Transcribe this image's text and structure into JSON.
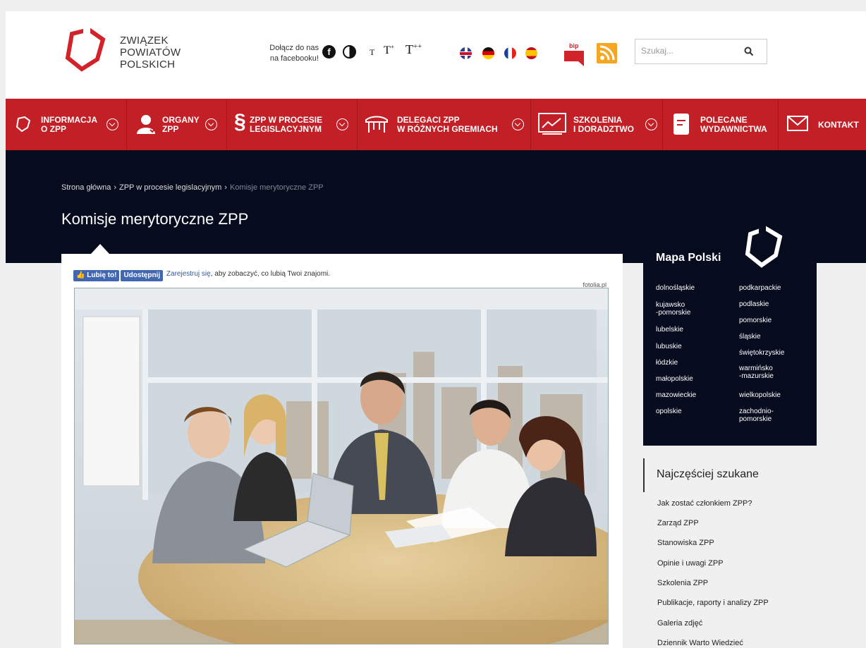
{
  "header": {
    "logo_lines": [
      "ZWIĄZEK",
      "POWIATÓW",
      "POLSKICH"
    ],
    "fb_join_line1": "Dołącz do nas",
    "fb_join_line2": "na facebooku!",
    "font_sizes": [
      "T",
      "T+",
      "T++"
    ],
    "languages": [
      "uk-flag",
      "german-flag",
      "french-flag",
      "spanish-flag"
    ],
    "bip_label": "bip",
    "search_placeholder": "Szukaj..."
  },
  "nav": {
    "items": [
      {
        "line1": "INFORMACJA",
        "line2": "O ZPP",
        "icon": "zpp-logo-icon",
        "has_dropdown": true
      },
      {
        "line1": "ORGANY",
        "line2": "ZPP",
        "icon": "user-icon",
        "has_dropdown": true
      },
      {
        "line1": "ZPP W PROCESIE",
        "line2": "LEGISLACYJNYM",
        "icon": "paragraph-icon",
        "has_dropdown": true
      },
      {
        "line1": "DELEGACI ZPP",
        "line2": "W RÓŻNYCH GREMIACH",
        "icon": "table-icon",
        "has_dropdown": true
      },
      {
        "line1": "SZKOLENIA",
        "line2": "I DORADZTWO",
        "icon": "presentation-icon",
        "has_dropdown": true
      },
      {
        "line1": "POLECANE",
        "line2": "WYDAWNICTWA",
        "icon": "book-icon",
        "has_dropdown": false
      },
      {
        "line1": "KONTAKT",
        "line2": "",
        "icon": "envelope-icon",
        "has_dropdown": false
      }
    ]
  },
  "breadcrumb": {
    "home": "Strona główna",
    "parent": "ZPP w procesie legislacyjnym",
    "current": "Komisje merytoryczne ZPP",
    "separator": "›"
  },
  "page_title": "Komisje merytoryczne ZPP",
  "facebook_bar": {
    "like": "Lubię to!",
    "share": "Udostępnij",
    "register": "Zarejestruj się",
    "rest": ", aby zobaczyć, co lubią Twoi znajomi."
  },
  "photo_credit": "fotolia.pl",
  "map": {
    "title": "Mapa Polski",
    "left_column": [
      [
        "dolnośląskie"
      ],
      [
        "kujawsko",
        "-pomorskie"
      ],
      [
        "lubelskie"
      ],
      [
        "lubuskie"
      ],
      [
        "łódzkie"
      ],
      [
        "małopolskie"
      ],
      [
        "mazowieckie"
      ],
      [
        "opolskie"
      ]
    ],
    "right_column": [
      [
        "podkarpackie"
      ],
      [
        "podlaskie"
      ],
      [
        "pomorskie"
      ],
      [
        "śląskie"
      ],
      [
        "świętokrzyskie"
      ],
      [
        "warmińsko",
        "-mazurskie"
      ],
      [
        "wielkopolskie"
      ],
      [
        "zachodnio-",
        "pomorskie"
      ]
    ]
  },
  "popular": {
    "title": "Najczęściej szukane",
    "links": [
      "Jak zostać członkiem ZPP?",
      "Zarząd ZPP",
      "Stanowiska ZPP",
      "Opinie i uwagi ZPP",
      "Szkolenia ZPP",
      "Publikacje, raporty i analizy ZPP",
      "Galeria zdjęć",
      "Dziennik Warto Wiedzieć"
    ]
  },
  "colors": {
    "nav_red": "#c31f26",
    "navy": "#060b1e",
    "page_bg": "#f0f0f0"
  }
}
